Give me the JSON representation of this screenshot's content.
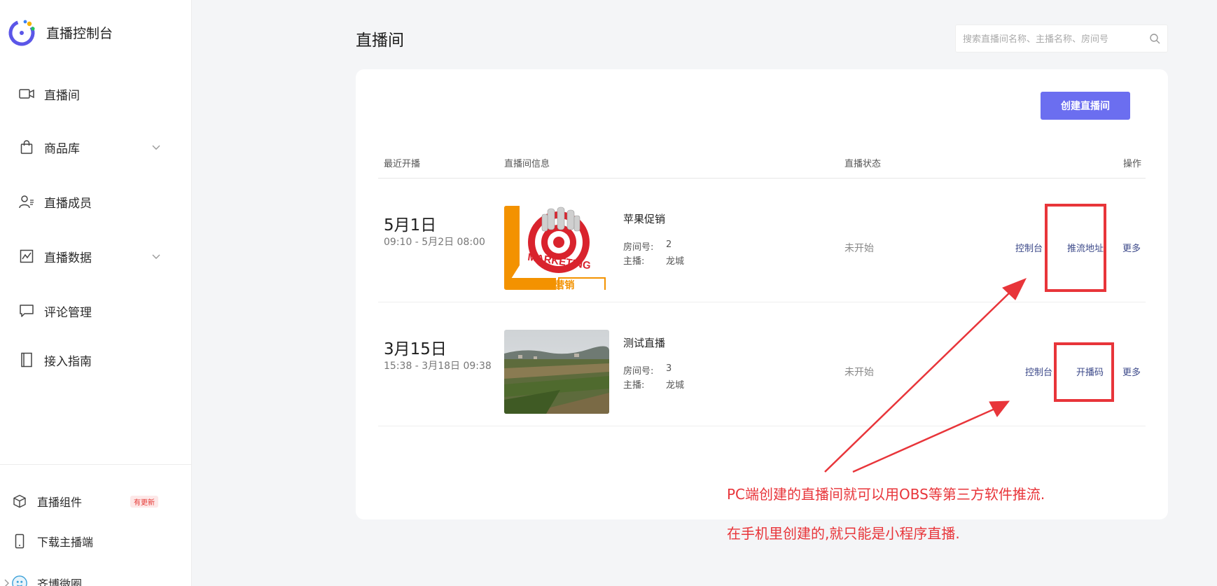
{
  "sidebar": {
    "brand_title": "直播控制台",
    "items": [
      {
        "label": "直播间",
        "icon": "video-camera-icon"
      },
      {
        "label": "商品库",
        "icon": "shopping-bag-icon",
        "has_children": true
      },
      {
        "label": "直播成员",
        "icon": "member-icon"
      },
      {
        "label": "直播数据",
        "icon": "chart-icon",
        "has_children": true
      },
      {
        "label": "评论管理",
        "icon": "comment-icon"
      },
      {
        "label": "接入指南",
        "icon": "book-icon"
      }
    ],
    "bottom_items": [
      {
        "label": "直播组件",
        "icon": "cube-icon",
        "badge": "有更新"
      },
      {
        "label": "下载主播端",
        "icon": "phone-icon"
      },
      {
        "label": "齐博微圈",
        "icon": "avatar-icon"
      }
    ]
  },
  "main": {
    "title": "直播间",
    "search_placeholder": "搜索直播间名称、主播名称、房间号",
    "create_button": "创建直播间",
    "columns": {
      "recent": "最近开播",
      "info": "直播间信息",
      "status": "直播状态",
      "actions": "操作"
    },
    "room_label": "房间号:",
    "host_label": "主播:",
    "rooms": [
      {
        "date": "5月1日",
        "time": "09:10 - 5月2日 08:00",
        "name": "苹果促销",
        "room_no": "2",
        "host": "龙城",
        "status": "未开始",
        "actions": [
          "控制台",
          "推流地址",
          "更多"
        ],
        "thumb_text": "MARKETING",
        "thumb_bottom_text": "市场 营销"
      },
      {
        "date": "3月15日",
        "time": "15:38 - 3月18日 09:38",
        "name": "测试直播",
        "room_no": "3",
        "host": "龙城",
        "status": "未开始",
        "actions": [
          "控制台",
          "开播码",
          "更多"
        ]
      }
    ]
  },
  "annotation": {
    "line1": "PC端创建的直播间就可以用OBS等第三方软件推流.",
    "line2": "在手机里创建的,就只能是小程序直播.",
    "color": "#e8353a"
  },
  "colors": {
    "accent": "#6b6ef0",
    "link": "#3d4a8a",
    "badge": "#e53935"
  }
}
